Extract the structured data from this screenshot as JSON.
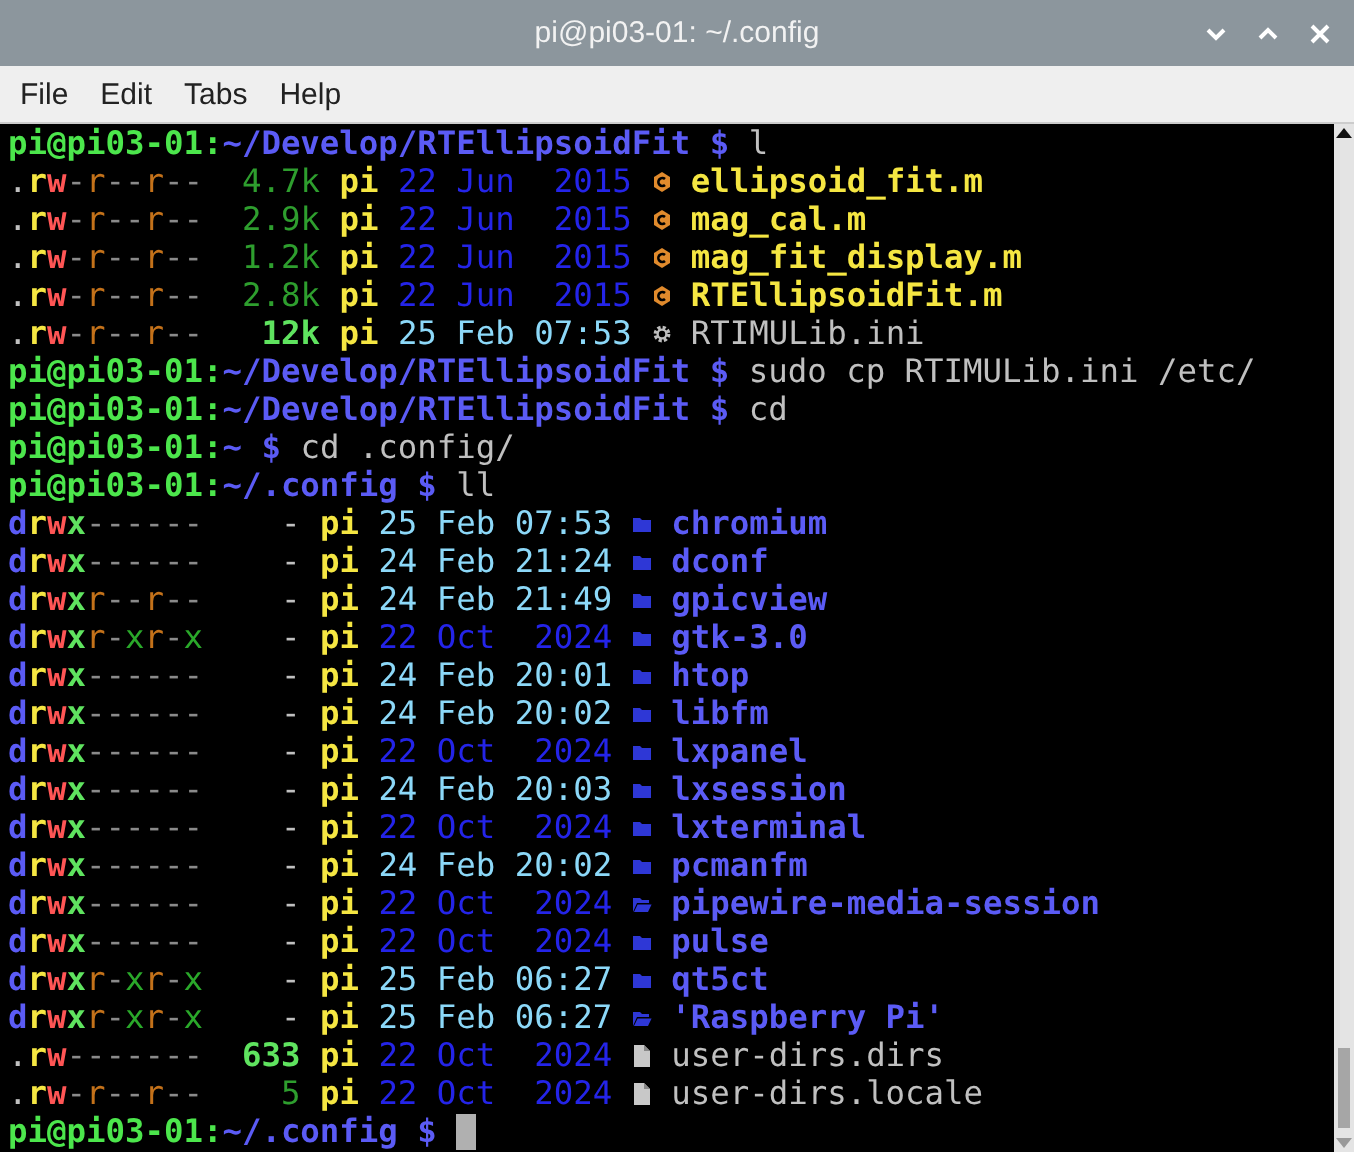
{
  "window": {
    "title": "pi@pi03-01: ~/.config"
  },
  "menu": [
    "File",
    "Edit",
    "Tabs",
    "Help"
  ],
  "terminal": [
    {
      "kind": "prompt",
      "user_host": "pi@pi03-01:",
      "path": "~/Develop/RTEllipsoidFit $",
      "command": "l",
      "cursor": false
    },
    {
      "kind": "listing",
      "entries": [
        {
          "perms": ".rw-r--r--",
          "size": "4.7k",
          "highlight": false,
          "owner": "pi",
          "date": "22 Jun  2015",
          "recent": false,
          "kind": "script",
          "name": "ellipsoid_fit.m"
        },
        {
          "perms": ".rw-r--r--",
          "size": "2.9k",
          "highlight": false,
          "owner": "pi",
          "date": "22 Jun  2015",
          "recent": false,
          "kind": "script",
          "name": "mag_cal.m"
        },
        {
          "perms": ".rw-r--r--",
          "size": "1.2k",
          "highlight": false,
          "owner": "pi",
          "date": "22 Jun  2015",
          "recent": false,
          "kind": "script",
          "name": "mag_fit_display.m"
        },
        {
          "perms": ".rw-r--r--",
          "size": "2.8k",
          "highlight": false,
          "owner": "pi",
          "date": "22 Jun  2015",
          "recent": false,
          "kind": "script",
          "name": "RTEllipsoidFit.m"
        },
        {
          "perms": ".rw-r--r--",
          "size": "12k",
          "highlight": true,
          "owner": "pi",
          "date": "25 Feb 07:53",
          "recent": true,
          "kind": "config",
          "name": "RTIMULib.ini"
        }
      ]
    },
    {
      "kind": "prompt",
      "user_host": "pi@pi03-01:",
      "path": "~/Develop/RTEllipsoidFit $",
      "command": "sudo cp RTIMULib.ini /etc/",
      "cursor": false
    },
    {
      "kind": "prompt",
      "user_host": "pi@pi03-01:",
      "path": "~/Develop/RTEllipsoidFit $",
      "command": "cd",
      "cursor": false
    },
    {
      "kind": "prompt",
      "user_host": "pi@pi03-01:",
      "path": "~ $",
      "command": "cd .config/",
      "cursor": false
    },
    {
      "kind": "prompt",
      "user_host": "pi@pi03-01:",
      "path": "~/.config $",
      "command": "ll",
      "cursor": false
    },
    {
      "kind": "listing",
      "entries": [
        {
          "perms": "drwx------",
          "size": "-",
          "owner": "pi",
          "date": "25 Feb 07:53",
          "recent": true,
          "kind": "dir",
          "name": "chromium"
        },
        {
          "perms": "drwx------",
          "size": "-",
          "owner": "pi",
          "date": "24 Feb 21:24",
          "recent": true,
          "kind": "dir",
          "name": "dconf"
        },
        {
          "perms": "drwxr--r--",
          "size": "-",
          "owner": "pi",
          "date": "24 Feb 21:49",
          "recent": true,
          "kind": "dir",
          "name": "gpicview"
        },
        {
          "perms": "drwxr-xr-x",
          "size": "-",
          "owner": "pi",
          "date": "22 Oct  2024",
          "recent": false,
          "kind": "dir",
          "name": "gtk-3.0"
        },
        {
          "perms": "drwx------",
          "size": "-",
          "owner": "pi",
          "date": "24 Feb 20:01",
          "recent": true,
          "kind": "dir",
          "name": "htop"
        },
        {
          "perms": "drwx------",
          "size": "-",
          "owner": "pi",
          "date": "24 Feb 20:02",
          "recent": true,
          "kind": "dir",
          "name": "libfm"
        },
        {
          "perms": "drwx------",
          "size": "-",
          "owner": "pi",
          "date": "22 Oct  2024",
          "recent": false,
          "kind": "dir",
          "name": "lxpanel"
        },
        {
          "perms": "drwx------",
          "size": "-",
          "owner": "pi",
          "date": "24 Feb 20:03",
          "recent": true,
          "kind": "dir",
          "name": "lxsession"
        },
        {
          "perms": "drwx------",
          "size": "-",
          "owner": "pi",
          "date": "22 Oct  2024",
          "recent": false,
          "kind": "dir",
          "name": "lxterminal"
        },
        {
          "perms": "drwx------",
          "size": "-",
          "owner": "pi",
          "date": "24 Feb 20:02",
          "recent": true,
          "kind": "dir",
          "name": "pcmanfm"
        },
        {
          "perms": "drwx------",
          "size": "-",
          "owner": "pi",
          "date": "22 Oct  2024",
          "recent": false,
          "kind": "opendir",
          "name": "pipewire-media-session"
        },
        {
          "perms": "drwx------",
          "size": "-",
          "owner": "pi",
          "date": "22 Oct  2024",
          "recent": false,
          "kind": "dir",
          "name": "pulse"
        },
        {
          "perms": "drwxr-xr-x",
          "size": "-",
          "owner": "pi",
          "date": "25 Feb 06:27",
          "recent": true,
          "kind": "dir",
          "name": "qt5ct"
        },
        {
          "perms": "drwxr-xr-x",
          "size": "-",
          "owner": "pi",
          "date": "25 Feb 06:27",
          "recent": true,
          "kind": "opendir",
          "name": "'Raspberry Pi'"
        },
        {
          "perms": ".rw-------",
          "size": "633",
          "highlight": true,
          "owner": "pi",
          "date": "22 Oct  2024",
          "recent": false,
          "kind": "file",
          "name": "user-dirs.dirs"
        },
        {
          "perms": ".rw-r--r--",
          "size": "5",
          "highlight": false,
          "owner": "pi",
          "date": "22 Oct  2024",
          "recent": false,
          "kind": "file",
          "name": "user-dirs.locale"
        }
      ]
    },
    {
      "kind": "prompt",
      "user_host": "pi@pi03-01:",
      "path": "~/.config $",
      "cursor": true
    }
  ]
}
